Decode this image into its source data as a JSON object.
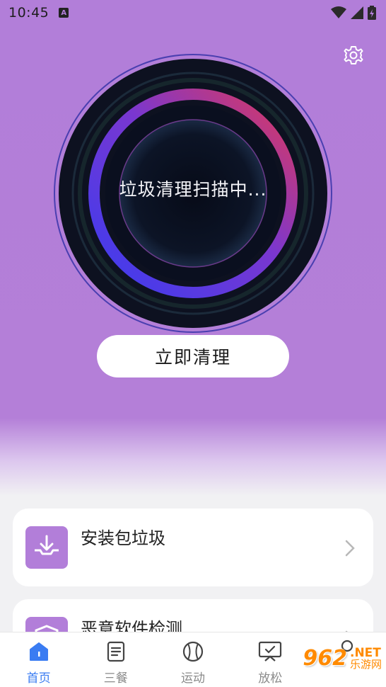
{
  "status": {
    "time": "10:45",
    "badge": "A"
  },
  "scan": {
    "status_text": "垃圾清理扫描中..."
  },
  "actions": {
    "clean_now": "立即清理"
  },
  "cards": [
    {
      "title": "安装包垃圾",
      "icon": "package-download-icon"
    },
    {
      "title": "恶意软件检测",
      "icon": "shield-icon"
    }
  ],
  "tabs": [
    {
      "label": "首页",
      "icon": "home-icon",
      "active": true
    },
    {
      "label": "三餐",
      "icon": "document-icon",
      "active": false
    },
    {
      "label": "运动",
      "icon": "ball-icon",
      "active": false
    },
    {
      "label": "放松",
      "icon": "screen-check-icon",
      "active": false
    },
    {
      "label": "",
      "icon": "profile-icon",
      "active": false
    }
  ],
  "watermark": {
    "number": "962",
    "suffix": ".NET",
    "site": "乐游网"
  },
  "colors": {
    "hero": "#b27ed9",
    "accent_blue": "#3a7cf2",
    "ring_start": "#3a3cf0",
    "ring_end": "#e0385a",
    "watermark": "#ff8a00"
  }
}
